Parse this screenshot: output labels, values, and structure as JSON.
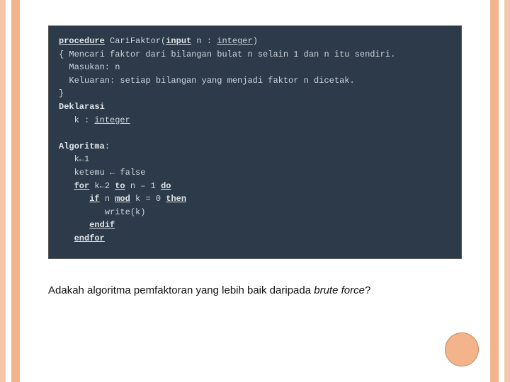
{
  "code": {
    "l1_a": "procedure",
    "l1_b": " CariFaktor(",
    "l1_c": "input",
    "l1_d": " n : ",
    "l1_e": "integer",
    "l1_f": ")",
    "l2": "{ Mencari faktor dari bilangan bulat n selain 1 dan n itu sendiri.",
    "l3": "  Masukan: n",
    "l4": "  Keluaran: setiap bilangan yang menjadi faktor n dicetak.",
    "l5": "}",
    "l6": "Deklarasi",
    "l7a": "   k : ",
    "l7b": "integer",
    "l8": "Algoritma",
    "l8colon": ":",
    "l9": "   k←1",
    "l10": "   ketemu ← false",
    "l11a": "   ",
    "l11b": "for",
    "l11c": " k←2 ",
    "l11d": "to",
    "l11e": " n – 1 ",
    "l11f": "do",
    "l12a": "      ",
    "l12b": "if",
    "l12c": " n ",
    "l12d": "mod",
    "l12e": " k = 0 ",
    "l12f": "then",
    "l13": "         write(k)",
    "l14a": "      ",
    "l14b": "endif",
    "l15a": "   ",
    "l15b": "endfor"
  },
  "question": {
    "text": "Adakah algoritma pemfaktoran yang lebih baik daripada ",
    "em": "brute force",
    "tail": "?"
  }
}
